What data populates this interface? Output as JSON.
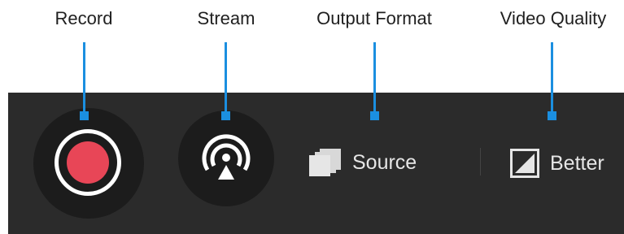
{
  "callouts": {
    "record": "Record",
    "stream": "Stream",
    "output_format": "Output Format",
    "video_quality": "Video Quality"
  },
  "toolbar": {
    "record": {
      "icon": "record-icon"
    },
    "stream": {
      "icon": "broadcast-icon"
    },
    "output_format": {
      "icon": "layers-icon",
      "value": "Source"
    },
    "video_quality": {
      "icon": "quality-icon",
      "value": "Better"
    }
  },
  "colors": {
    "accent": "#1b8fe0",
    "record_red": "#e84657",
    "toolbar_bg": "#2b2b2b",
    "button_bg": "#1c1c1c"
  }
}
